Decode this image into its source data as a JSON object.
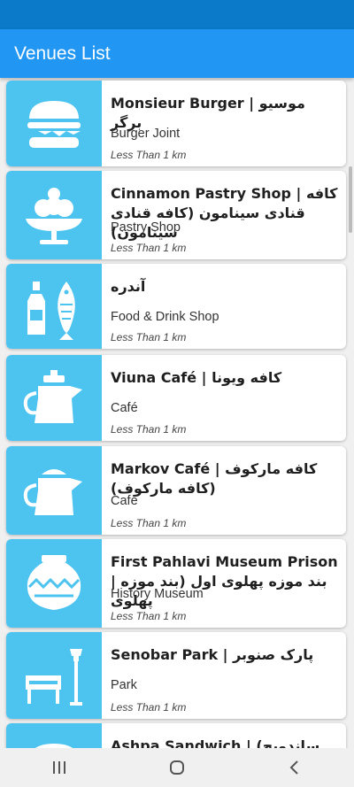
{
  "app": {
    "title": "Venues List"
  },
  "venues": [
    {
      "title": "Monsieur Burger | موسیو برگر",
      "category": "Burger Joint",
      "distance": "Less Than 1 km",
      "icon": "burger-icon"
    },
    {
      "title": "Cinnamon Pastry Shop | کافه قنادی سینامون (کافه قنادی سینامون)",
      "category": "Pastry Shop",
      "distance": "Less Than 1 km",
      "icon": "ice-cream-icon"
    },
    {
      "title": "آندره",
      "category": "Food & Drink Shop",
      "distance": "Less Than 1 km",
      "icon": "bottle-fish-icon"
    },
    {
      "title": "Viuna Café | کافه ویونا",
      "category": "Café",
      "distance": "Less Than 1 km",
      "icon": "teapot-icon"
    },
    {
      "title": "Markov Café | کافه مارکوف (کافه مارکوف)",
      "category": "Café",
      "distance": "Less Than 1 km",
      "icon": "teapot-icon"
    },
    {
      "title": "First Pahlavi Museum Prison | بند موزه پهلوی اول (بند موزه پهلوی",
      "category": "History Museum",
      "distance": "Less Than 1 km",
      "icon": "vase-icon"
    },
    {
      "title": "Senobar Park | پارک صنوبر",
      "category": "Park",
      "distance": "Less Than 1 km",
      "icon": "park-bench-icon"
    },
    {
      "title": "Ashpa Sandwich | (ساندویچ آشپا)",
      "category": "",
      "distance": "",
      "icon": "burger-icon"
    }
  ],
  "colors": {
    "status_bar": "#0a7ac9",
    "app_bar": "#2196f3",
    "thumb": "#4dc3f0"
  }
}
